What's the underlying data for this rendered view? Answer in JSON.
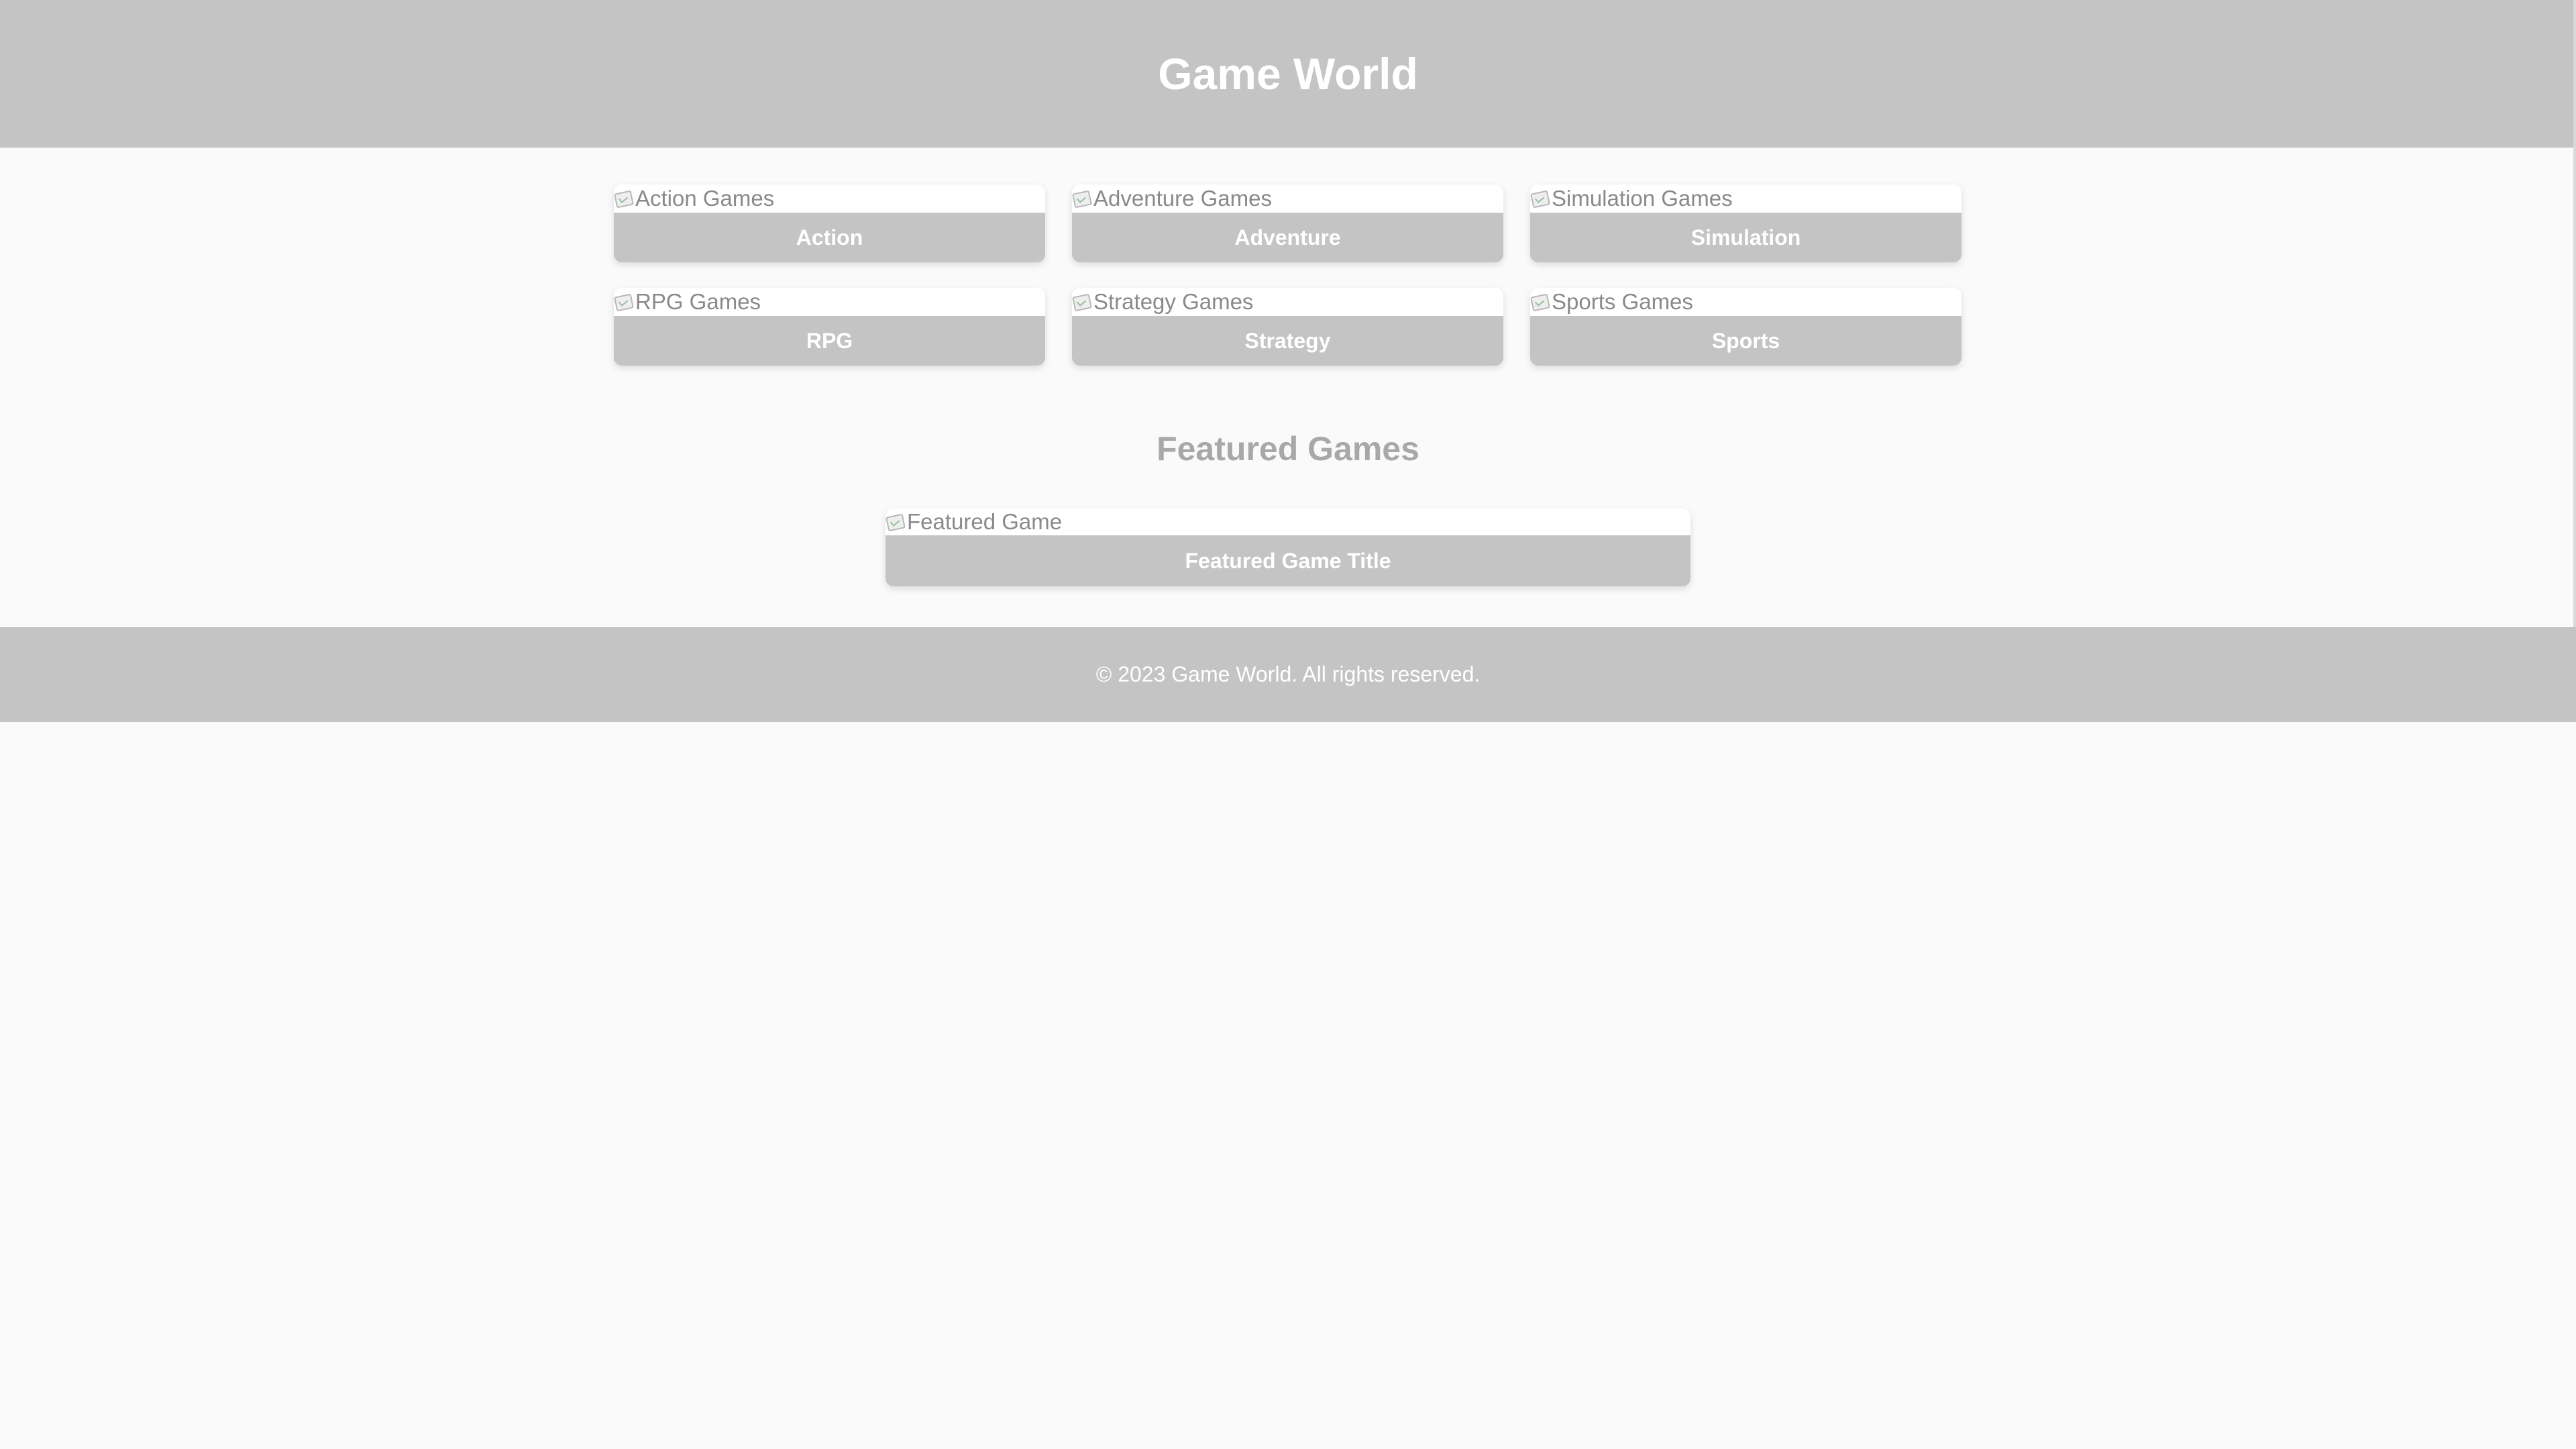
{
  "header": {
    "title": "Game World"
  },
  "categories": {
    "rows": [
      [
        {
          "image_alt": "Action Games",
          "label": "Action"
        },
        {
          "image_alt": "Adventure Games",
          "label": "Adventure"
        },
        {
          "image_alt": "Simulation Games",
          "label": "Simulation"
        }
      ],
      [
        {
          "image_alt": "RPG Games",
          "label": "RPG"
        },
        {
          "image_alt": "Strategy Games",
          "label": "Strategy"
        },
        {
          "image_alt": "Sports Games",
          "label": "Sports"
        }
      ]
    ]
  },
  "featured": {
    "heading": "Featured Games",
    "image_alt": "Featured Game",
    "game_title": "Featured Game Title"
  },
  "footer": {
    "copyright": "© 2023 Game World. All rights reserved."
  },
  "colors": {
    "header_bg": "#c4c4c4",
    "page_bg": "#fafafa",
    "button_bg": "#c4c4c4",
    "heading_text": "#a8a8a8"
  }
}
